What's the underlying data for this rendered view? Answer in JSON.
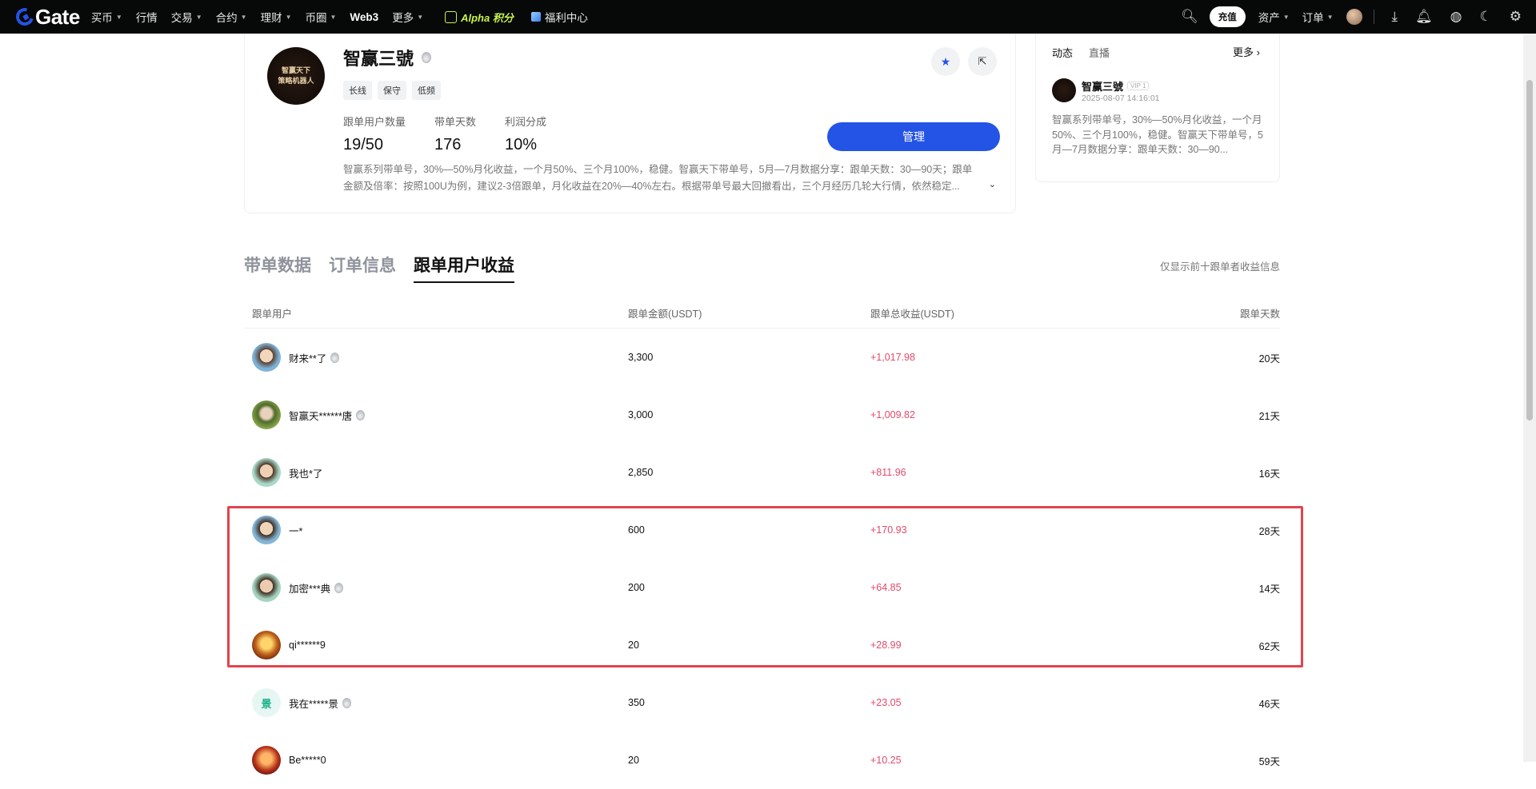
{
  "nav": {
    "logo": "Gate",
    "items": [
      {
        "label": "买币",
        "caret": true
      },
      {
        "label": "行情",
        "caret": false
      },
      {
        "label": "交易",
        "caret": true
      },
      {
        "label": "合约",
        "caret": true
      },
      {
        "label": "理财",
        "caret": true
      },
      {
        "label": "币圈",
        "caret": true
      },
      {
        "label": "Web3",
        "caret": false
      },
      {
        "label": "更多",
        "caret": true
      }
    ],
    "alpha_label": "Alpha 积分",
    "welfare_label": "福利中心",
    "deposit_label": "充值",
    "assets_label": "资产",
    "orders_label": "订单",
    "icons": [
      "search-icon",
      "download-icon",
      "bell-icon",
      "globe-icon",
      "moon-icon",
      "gear-icon"
    ]
  },
  "profile": {
    "avatar_text_1": "智赢天下",
    "avatar_text_2": "策略机器人",
    "name": "智赢三號",
    "tags": [
      "长线",
      "保守",
      "低频"
    ],
    "stats": [
      {
        "label": "跟单用户数量",
        "value": "19/50"
      },
      {
        "label": "带单天数",
        "value": "176"
      },
      {
        "label": "利润分成",
        "value": "10%"
      }
    ],
    "description_line1": "智赢系列带单号，30%—50%月化收益，一个月50%、三个月100%，稳健。智赢天下带单号，5月—7月数据分享：跟单天数：30—90天；跟单",
    "description_line2": "金额及倍率：按照100U为例，建议2-3倍跟单，月化收益在20%—40%左右。根据带单号最大回撤看出，三个月经历几轮大行情，依然稳定...",
    "manage_label": "管理",
    "accent_color": "#2354e6"
  },
  "feed": {
    "tab_dynamic": "动态",
    "tab_live": "直播",
    "more_label": "更多",
    "post_name": "智赢三號",
    "post_vip": "VIP 1",
    "post_time": "2025-08-07 14:16:01",
    "post_text": "智赢系列带单号，30%—50%月化收益，一个月50%、三个月100%，稳健。智赢天下带单号，5月—7月数据分享：跟单天数：30—90..."
  },
  "tabs": {
    "items": [
      "带单数据",
      "订单信息",
      "跟单用户收益"
    ],
    "active_index": 2,
    "note": "仅显示前十跟单者收益信息"
  },
  "table": {
    "headers": {
      "user": "跟单用户",
      "amount": "跟单金额(USDT)",
      "profit": "跟单总收益(USDT)",
      "days": "跟单天数"
    },
    "rows": [
      {
        "user": "财来**了",
        "medal": true,
        "amount": "3,300",
        "profit": "+1,017.98",
        "days": "20天",
        "avatar": "av1",
        "avatar_text": ""
      },
      {
        "user": "智赢天******唐",
        "medal": true,
        "amount": "3,000",
        "profit": "+1,009.82",
        "days": "21天",
        "avatar": "av2",
        "avatar_text": ""
      },
      {
        "user": "我也*了",
        "medal": false,
        "amount": "2,850",
        "profit": "+811.96",
        "days": "16天",
        "avatar": "av3",
        "avatar_text": ""
      },
      {
        "user": "一*",
        "medal": false,
        "amount": "600",
        "profit": "+170.93",
        "days": "28天",
        "avatar": "av4",
        "avatar_text": ""
      },
      {
        "user": "加密***典",
        "medal": true,
        "amount": "200",
        "profit": "+64.85",
        "days": "14天",
        "avatar": "av5",
        "avatar_text": ""
      },
      {
        "user": "qi******9",
        "medal": false,
        "amount": "20",
        "profit": "+28.99",
        "days": "62天",
        "avatar": "av6",
        "avatar_text": ""
      },
      {
        "user": "我在*****景",
        "medal": true,
        "amount": "350",
        "profit": "+23.05",
        "days": "46天",
        "avatar": "av7",
        "avatar_text": "景"
      },
      {
        "user": "Be*****0",
        "medal": false,
        "amount": "20",
        "profit": "+10.25",
        "days": "59天",
        "avatar": "av8",
        "avatar_text": ""
      }
    ],
    "profit_color": "#e04a6a",
    "highlight_color": "#e0444e"
  }
}
